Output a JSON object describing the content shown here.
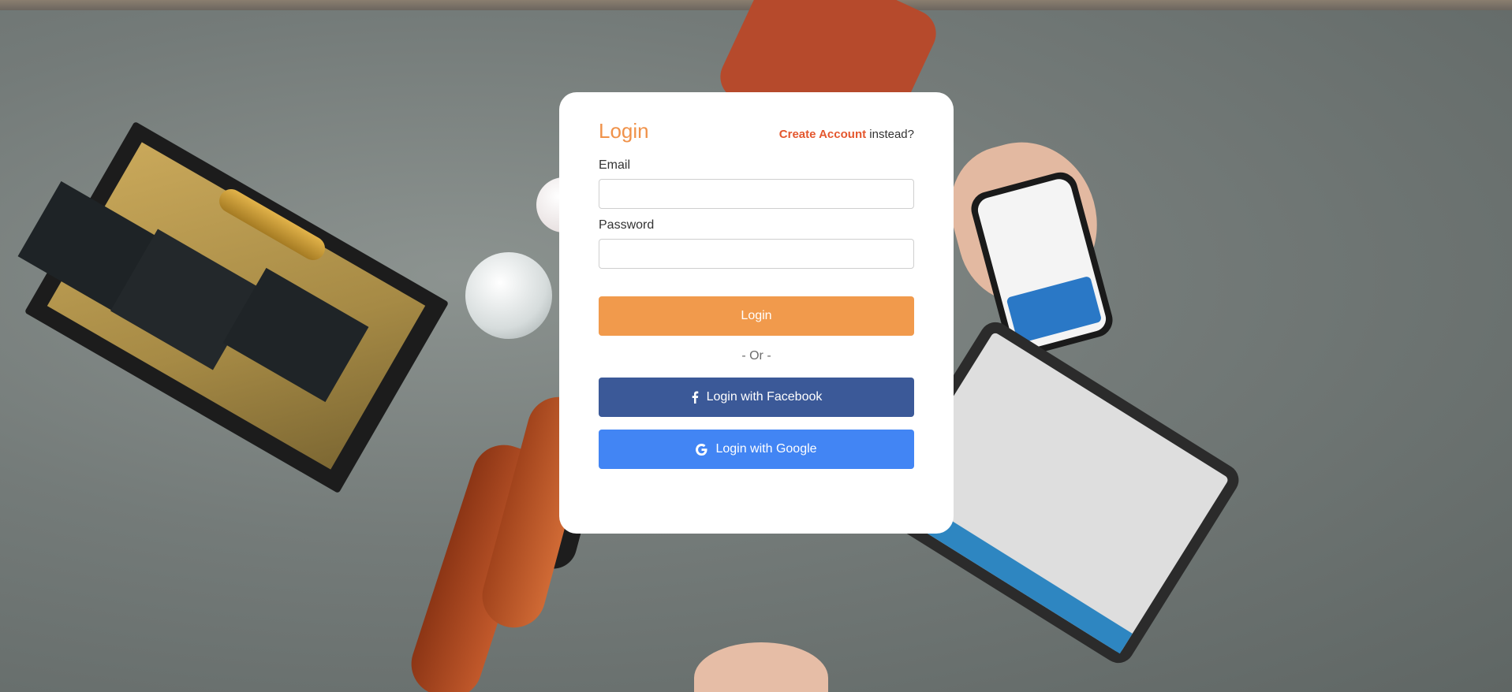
{
  "login_form": {
    "title": "Login",
    "switch_link": "Create Account",
    "switch_suffix": " instead?",
    "email_label": "Email",
    "email_value": "",
    "password_label": "Password",
    "password_value": "",
    "submit_label": "Login",
    "divider": "- Or -",
    "facebook_label": "Login with Facebook",
    "google_label": "Login with Google"
  },
  "icons": {
    "facebook": "facebook-icon",
    "google": "google-icon"
  },
  "colors": {
    "accent": "#f0924a",
    "link": "#e4572e",
    "facebook": "#3b5998",
    "google": "#4285f4"
  }
}
